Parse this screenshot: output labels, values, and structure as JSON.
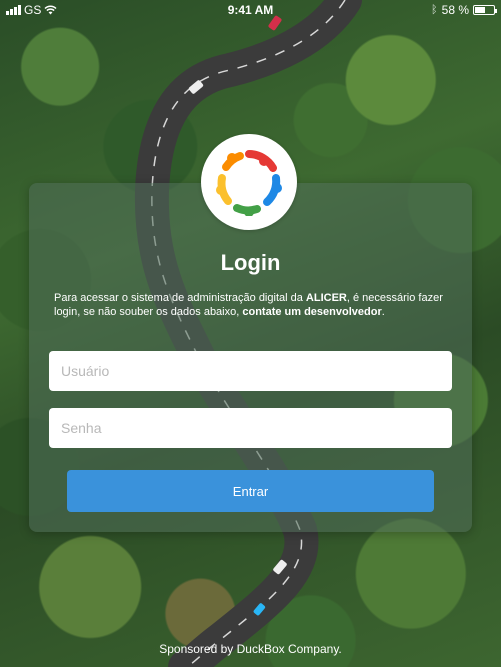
{
  "status_bar": {
    "carrier": "GS",
    "time": "9:41 AM",
    "battery_text": "58 %",
    "battery_level": 0.58
  },
  "logo": {
    "icon": "people-circle-logo"
  },
  "login": {
    "title": "Login",
    "desc_part1": "Para acessar o sistema de administração digital da ",
    "desc_brand": "ALICER",
    "desc_part2": ", é necessário fazer login, se não souber os dados abaixo, ",
    "desc_contact": "contate um desenvolvedor",
    "desc_part3": ".",
    "user_placeholder": "Usuário",
    "user_value": "",
    "password_placeholder": "Senha",
    "password_value": "",
    "submit_label": "Entrar"
  },
  "footer": {
    "text": "Sponsored by DuckBox Company."
  },
  "colors": {
    "accent": "#3a92db",
    "logo_red": "#e53935",
    "logo_blue": "#1e88e5",
    "logo_green": "#43a047",
    "logo_yellow": "#fbc02d",
    "logo_orange": "#fb8c00"
  }
}
